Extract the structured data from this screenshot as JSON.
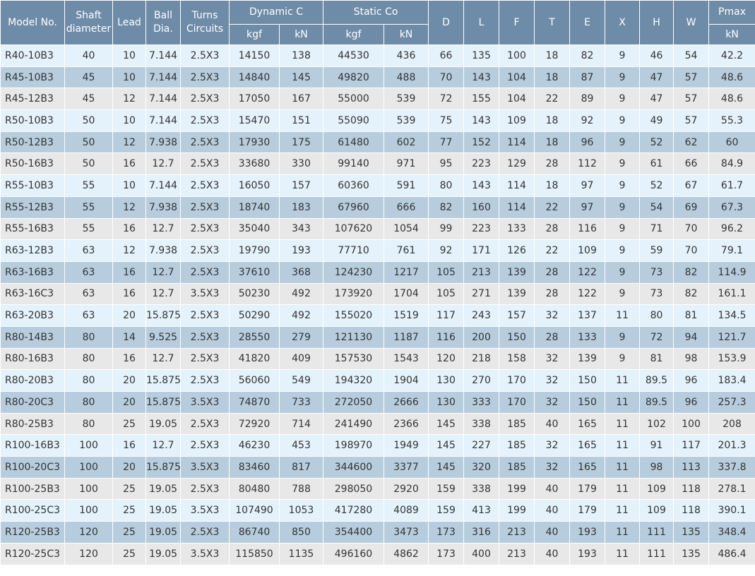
{
  "headers": {
    "model": "Model No.",
    "shaft": "Shaft diameter",
    "lead": "Lead",
    "ball": "Ball Dia.",
    "turns": "Turns Circuits",
    "dynamic": "Dynamic C",
    "static": "Static Co",
    "D": "D",
    "L": "L",
    "F": "F",
    "T": "T",
    "E": "E",
    "X": "X",
    "H": "H",
    "W": "W",
    "pmax": "Pmax",
    "kgf": "kgf",
    "kn": "kN"
  },
  "rows": [
    [
      "R40-10B3",
      "40",
      "10",
      "7.144",
      "2.5X3",
      "14150",
      "138",
      "44530",
      "436",
      "66",
      "135",
      "100",
      "18",
      "82",
      "9",
      "46",
      "54",
      "42.2"
    ],
    [
      "R45-10B3",
      "45",
      "10",
      "7.144",
      "2.5X3",
      "14840",
      "145",
      "49820",
      "488",
      "70",
      "143",
      "104",
      "18",
      "87",
      "9",
      "47",
      "57",
      "48.6"
    ],
    [
      "R45-12B3",
      "45",
      "12",
      "7.144",
      "2.5X3",
      "17050",
      "167",
      "55000",
      "539",
      "72",
      "155",
      "104",
      "22",
      "89",
      "9",
      "47",
      "57",
      "48.6"
    ],
    [
      "R50-10B3",
      "50",
      "10",
      "7.144",
      "2.5X3",
      "15470",
      "151",
      "55090",
      "539",
      "75",
      "143",
      "109",
      "18",
      "92",
      "9",
      "49",
      "57",
      "55.3"
    ],
    [
      "R50-12B3",
      "50",
      "12",
      "7.938",
      "2.5X3",
      "17930",
      "175",
      "61480",
      "602",
      "77",
      "152",
      "114",
      "18",
      "96",
      "9",
      "52",
      "62",
      "60"
    ],
    [
      "R50-16B3",
      "50",
      "16",
      "12.7",
      "2.5X3",
      "33680",
      "330",
      "99140",
      "971",
      "95",
      "223",
      "129",
      "28",
      "112",
      "9",
      "61",
      "66",
      "84.9"
    ],
    [
      "R55-10B3",
      "55",
      "10",
      "7.144",
      "2.5X3",
      "16050",
      "157",
      "60360",
      "591",
      "80",
      "143",
      "114",
      "18",
      "97",
      "9",
      "52",
      "67",
      "61.7"
    ],
    [
      "R55-12B3",
      "55",
      "12",
      "7.938",
      "2.5X3",
      "18740",
      "183",
      "67960",
      "666",
      "82",
      "160",
      "114",
      "22",
      "97",
      "9",
      "54",
      "69",
      "67.3"
    ],
    [
      "R55-16B3",
      "55",
      "16",
      "12.7",
      "2.5X3",
      "35040",
      "343",
      "107620",
      "1054",
      "99",
      "223",
      "133",
      "28",
      "116",
      "9",
      "71",
      "70",
      "96.2"
    ],
    [
      "R63-12B3",
      "63",
      "12",
      "7.938",
      "2.5X3",
      "19790",
      "193",
      "77710",
      "761",
      "92",
      "171",
      "126",
      "22",
      "109",
      "9",
      "59",
      "70",
      "79.1"
    ],
    [
      "R63-16B3",
      "63",
      "16",
      "12.7",
      "2.5X3",
      "37610",
      "368",
      "124230",
      "1217",
      "105",
      "213",
      "139",
      "28",
      "122",
      "9",
      "73",
      "82",
      "114.9"
    ],
    [
      "R63-16C3",
      "63",
      "16",
      "12.7",
      "3.5X3",
      "50230",
      "492",
      "173920",
      "1704",
      "105",
      "271",
      "139",
      "28",
      "122",
      "9",
      "73",
      "82",
      "161.1"
    ],
    [
      "R63-20B3",
      "63",
      "20",
      "15.875",
      "2.5X3",
      "50290",
      "492",
      "155020",
      "1519",
      "117",
      "243",
      "157",
      "32",
      "137",
      "11",
      "80",
      "81",
      "134.5"
    ],
    [
      "R80-14B3",
      "80",
      "14",
      "9.525",
      "2.5X3",
      "28550",
      "279",
      "121130",
      "1187",
      "116",
      "200",
      "150",
      "28",
      "133",
      "9",
      "72",
      "94",
      "121.7"
    ],
    [
      "R80-16B3",
      "80",
      "16",
      "12.7",
      "2.5X3",
      "41820",
      "409",
      "157530",
      "1543",
      "120",
      "218",
      "158",
      "32",
      "139",
      "9",
      "81",
      "98",
      "153.9"
    ],
    [
      "R80-20B3",
      "80",
      "20",
      "15.875",
      "2.5X3",
      "56060",
      "549",
      "194320",
      "1904",
      "130",
      "270",
      "170",
      "32",
      "150",
      "11",
      "89.5",
      "96",
      "183.4"
    ],
    [
      "R80-20C3",
      "80",
      "20",
      "15.875",
      "3.5X3",
      "74870",
      "733",
      "272050",
      "2666",
      "130",
      "333",
      "170",
      "32",
      "150",
      "11",
      "89.5",
      "96",
      "257.3"
    ],
    [
      "R80-25B3",
      "80",
      "25",
      "19.05",
      "2.5X3",
      "72920",
      "714",
      "241490",
      "2366",
      "145",
      "338",
      "185",
      "40",
      "165",
      "11",
      "102",
      "100",
      "208"
    ],
    [
      "R100-16B3",
      "100",
      "16",
      "12.7",
      "2.5X3",
      "46230",
      "453",
      "198970",
      "1949",
      "145",
      "227",
      "185",
      "32",
      "165",
      "11",
      "91",
      "117",
      "201.3"
    ],
    [
      "R100-20C3",
      "100",
      "20",
      "15.875",
      "3.5X3",
      "83460",
      "817",
      "344600",
      "3377",
      "145",
      "320",
      "185",
      "32",
      "165",
      "11",
      "98",
      "113",
      "337.8"
    ],
    [
      "R100-25B3",
      "100",
      "25",
      "19.05",
      "2.5X3",
      "80480",
      "788",
      "298050",
      "2920",
      "159",
      "338",
      "199",
      "40",
      "179",
      "11",
      "109",
      "118",
      "278.1"
    ],
    [
      "R100-25C3",
      "100",
      "25",
      "19.05",
      "3.5X3",
      "107490",
      "1053",
      "417280",
      "4089",
      "159",
      "413",
      "199",
      "40",
      "179",
      "11",
      "109",
      "118",
      "390.1"
    ],
    [
      "R120-25B3",
      "120",
      "25",
      "19.05",
      "2.5X3",
      "86740",
      "850",
      "354400",
      "3473",
      "173",
      "316",
      "213",
      "40",
      "193",
      "11",
      "111",
      "135",
      "348.4"
    ],
    [
      "R120-25C3",
      "120",
      "25",
      "19.05",
      "3.5X3",
      "115850",
      "1135",
      "496160",
      "4862",
      "173",
      "400",
      "213",
      "40",
      "193",
      "11",
      "111",
      "135",
      "486.4"
    ]
  ]
}
